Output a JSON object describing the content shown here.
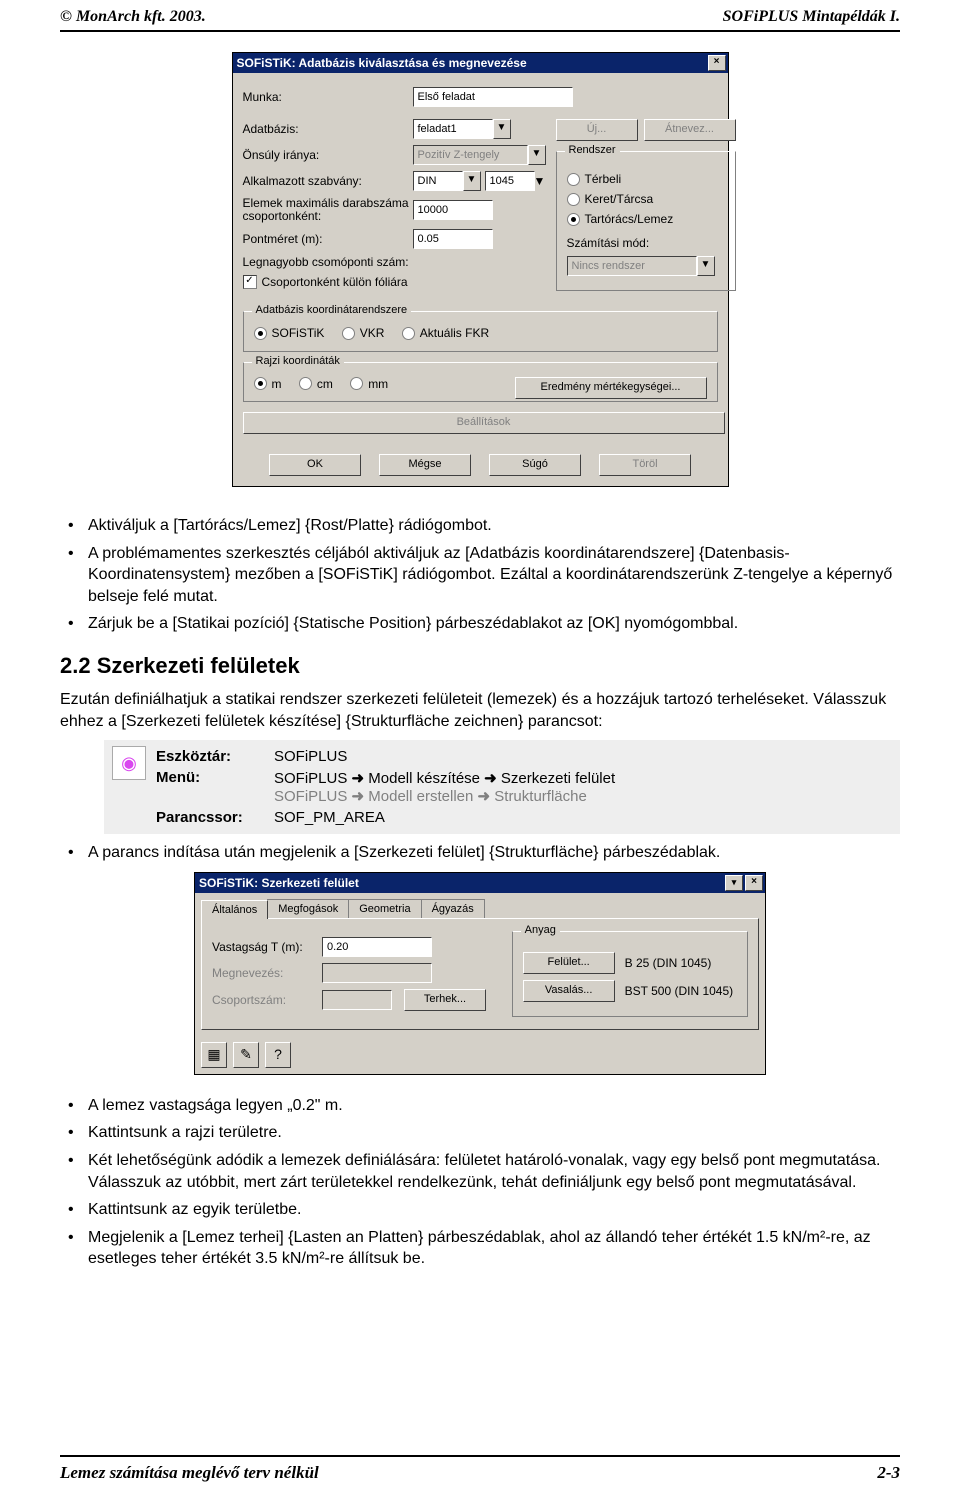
{
  "header": {
    "left": "© MonArch kft. 2003.",
    "right": "SOFiPLUS Mintapéldák I."
  },
  "footer": {
    "left": "Lemez számítása meglévő terv nélkül",
    "right": "2-3"
  },
  "dlg1": {
    "title": "SOFiSTiK: Adatbázis kiválasztása és megnevezése",
    "munka_l": "Munka:",
    "munka_v": "Első feladat",
    "adat_l": "Adatbázis:",
    "adat_v": "feladat1",
    "uj": "Új...",
    "atnevez": "Átnevez...",
    "onsuly_l": "Önsúly iránya:",
    "onsuly_v": "Pozitív Z-tengely",
    "szab_l": "Alkalmazott szabvány:",
    "szab_v": "DIN",
    "szab_n": "1045",
    "elem_l": "Elemek maximális darabszáma csoportonként:",
    "elem_v": "10000",
    "pont_l": "Pontméret (m):",
    "pont_v": "0.05",
    "cspt_l": "Legnagyobb csomóponti szám:",
    "kulon": "Csoportonként külön fóliára",
    "rendszer_t": "Rendszer",
    "r1": "Térbeli",
    "r2": "Keret/Tárcsa",
    "r3": "Tartórács/Lemez",
    "szmod_l": "Számítási mód:",
    "szmod_v": "Nincs rendszer",
    "koord_t": "Adatbázis koordinátarendszere",
    "k1": "SOFiSTiK",
    "k2": "VKR",
    "k3": "Aktuális FKR",
    "rajzi_t": "Rajzi koordináták",
    "u1": "m",
    "u2": "cm",
    "u3": "mm",
    "ered": "Eredmény mértékegységei...",
    "beall": "Beállítások",
    "ok": "OK",
    "megse": "Mégse",
    "sugo": "Súgó",
    "torol": "Töröl"
  },
  "bul1": [
    "Aktiváljuk a [Tartórács/Lemez] {Rost/Platte} rádiógombot.",
    "A problémamentes szerkesztés céljából aktiváljuk az [Adatbázis koordinátarendszere] {Datenbasis-Koordinatensystem} mezőben a [SOFiSTiK] rádiógombot. Ezáltal a koordinátarendszerünk Z-tengelye a képernyő belseje felé mutat.",
    "Zárjuk be a [Statikai pozíció] {Statische Position} párbeszédablakot az [OK] nyomógombbal."
  ],
  "sec": "2.2 Szerkezeti felületek",
  "para": "Ezután definiálhatjuk a statikai rendszer szerkezeti felületeit (lemezek) és a hozzájuk tartozó terheléseket. Válasszuk ehhez a [Szerkezeti felületek készítése] {Strukturfläche zeichnen} parancsot:",
  "cmd": {
    "k1": "Eszköztár:",
    "v1": "SOFiPLUS",
    "k2": "Menü:",
    "v2a": "SOFiPLUS",
    "v2b": "Modell készítése",
    "v2c": "Szerkezeti felület",
    "v2d": "SOFiPLUS",
    "v2e": "Modell erstellen",
    "v2f": "Strukturfläche",
    "k3": "Parancssor:",
    "v3": "SOF_PM_AREA"
  },
  "bul2": "A parancs indítása után megjelenik a [Szerkezeti felület] {Strukturfläche} párbeszédablak.",
  "dlg2": {
    "title": "SOFiSTiK: Szerkezeti felület",
    "tabs": [
      "Általános",
      "Megfogások",
      "Geometria",
      "Ágyazás"
    ],
    "vast_l": "Vastagság T (m):",
    "vast_v": "0.20",
    "megn_l": "Megnevezés:",
    "cssz_l": "Csoportszám:",
    "terh": "Terhek...",
    "anyag_t": "Anyag",
    "felulet": "Felület...",
    "felulet_v": "B 25 (DIN 1045)",
    "vasalas": "Vasalás...",
    "vasalas_v": "BST 500 (DIN 1045)"
  },
  "bul3": [
    "A lemez vastagsága legyen „0.2\" m.",
    "Kattintsunk a rajzi területre.",
    "Két lehetőségünk adódik a lemezek definiálására: felületet határoló-vonalak, vagy egy belső pont megmutatása. Válasszuk az utóbbit, mert zárt területekkel rendelkezünk, tehát definiáljunk egy belső pont megmutatásával.",
    "Kattintsunk az egyik területbe.",
    "Megjelenik a [Lemez terhei] {Lasten an Platten} párbeszédablak, ahol az állandó teher értékét 1.5 kN/m²-re, az esetleges teher értékét 3.5 kN/m²-re állítsuk be."
  ]
}
